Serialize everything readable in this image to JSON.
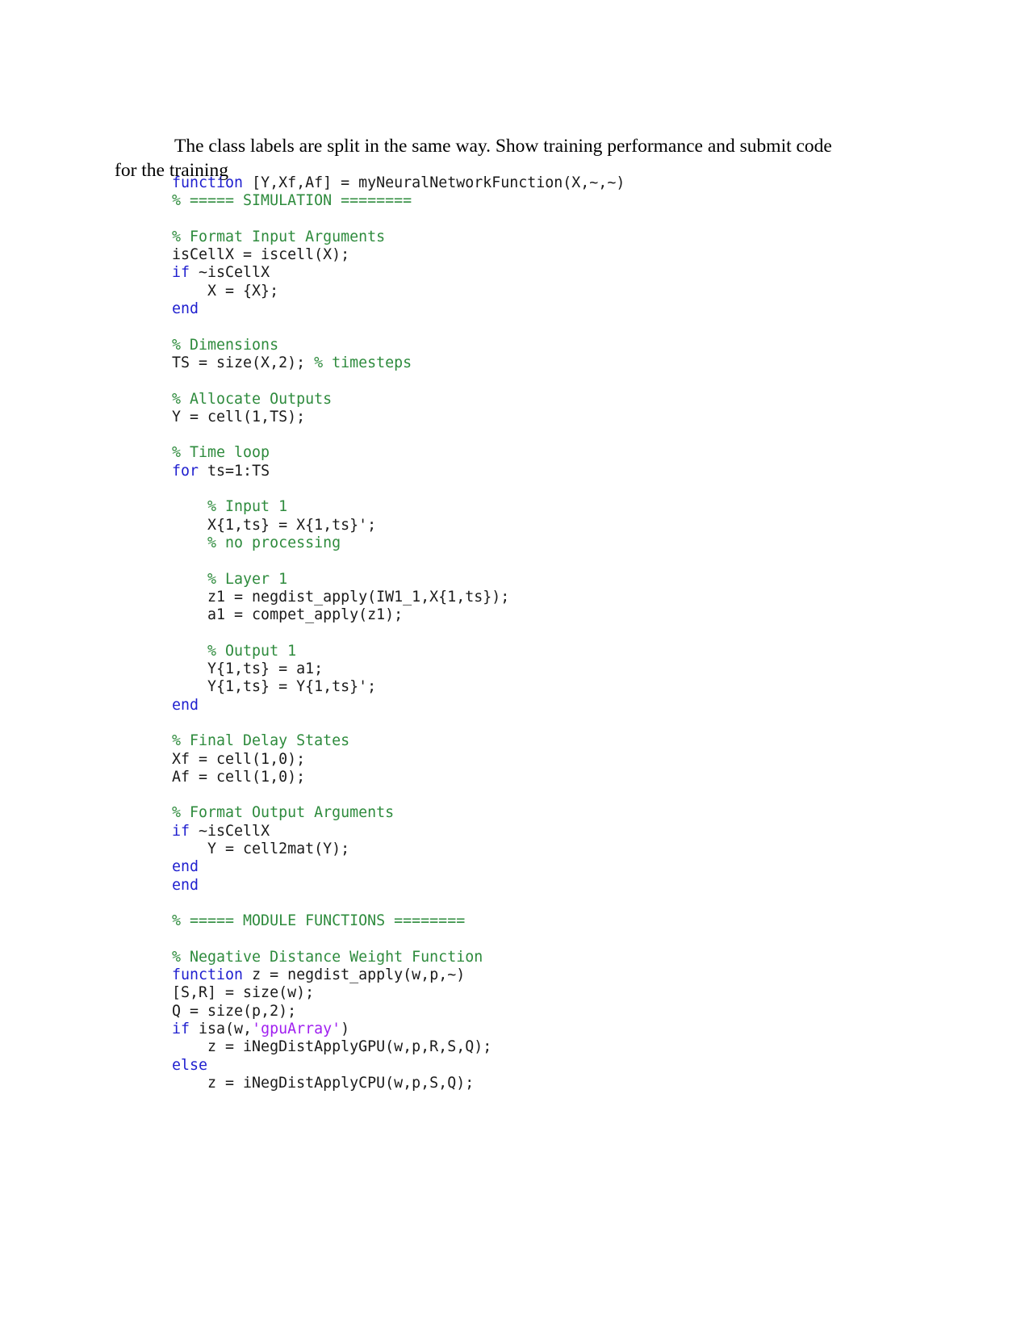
{
  "document": {
    "paragraph": "The class labels are split in the same way. Show training performance and submit code for the training",
    "colors": {
      "keyword": "#1f1fcf",
      "comment": "#2e8b3d",
      "string": "#a020f0",
      "plain": "#1a1a1a",
      "page_background": "#ffffff"
    },
    "code_listing": {
      "language": "matlab",
      "lines": [
        [
          {
            "t": "function",
            "c": "kw"
          },
          {
            "t": " [Y,Xf,Af] = myNeuralNetworkFunction(X,~,~)",
            "c": "plain"
          }
        ],
        [
          {
            "t": "% ===== SIMULATION ========",
            "c": "cmt"
          }
        ],
        [
          {
            "t": "",
            "c": "plain"
          }
        ],
        [
          {
            "t": "% Format Input Arguments",
            "c": "cmt"
          }
        ],
        [
          {
            "t": "isCellX = iscell(X);",
            "c": "plain"
          }
        ],
        [
          {
            "t": "if",
            "c": "kw"
          },
          {
            "t": " ~isCellX",
            "c": "plain"
          }
        ],
        [
          {
            "t": "    X = {X};",
            "c": "plain"
          }
        ],
        [
          {
            "t": "end",
            "c": "kw"
          }
        ],
        [
          {
            "t": "",
            "c": "plain"
          }
        ],
        [
          {
            "t": "% Dimensions",
            "c": "cmt"
          }
        ],
        [
          {
            "t": "TS = size(X,2); ",
            "c": "plain"
          },
          {
            "t": "% timesteps",
            "c": "cmt"
          }
        ],
        [
          {
            "t": "",
            "c": "plain"
          }
        ],
        [
          {
            "t": "% Allocate Outputs",
            "c": "cmt"
          }
        ],
        [
          {
            "t": "Y = cell(1,TS);",
            "c": "plain"
          }
        ],
        [
          {
            "t": "",
            "c": "plain"
          }
        ],
        [
          {
            "t": "% Time loop",
            "c": "cmt"
          }
        ],
        [
          {
            "t": "for",
            "c": "kw"
          },
          {
            "t": " ts=1:TS",
            "c": "plain"
          }
        ],
        [
          {
            "t": "",
            "c": "plain"
          }
        ],
        [
          {
            "t": "    % Input 1",
            "c": "cmt"
          }
        ],
        [
          {
            "t": "    X{1,ts} = X{1,ts}';",
            "c": "plain"
          }
        ],
        [
          {
            "t": "    % no processing",
            "c": "cmt"
          }
        ],
        [
          {
            "t": "",
            "c": "plain"
          }
        ],
        [
          {
            "t": "    % Layer 1",
            "c": "cmt"
          }
        ],
        [
          {
            "t": "    z1 = negdist_apply(IW1_1,X{1,ts});",
            "c": "plain"
          }
        ],
        [
          {
            "t": "    a1 = compet_apply(z1);",
            "c": "plain"
          }
        ],
        [
          {
            "t": "",
            "c": "plain"
          }
        ],
        [
          {
            "t": "    % Output 1",
            "c": "cmt"
          }
        ],
        [
          {
            "t": "    Y{1,ts} = a1;",
            "c": "plain"
          }
        ],
        [
          {
            "t": "    Y{1,ts} = Y{1,ts}';",
            "c": "plain"
          }
        ],
        [
          {
            "t": "end",
            "c": "kw"
          }
        ],
        [
          {
            "t": "",
            "c": "plain"
          }
        ],
        [
          {
            "t": "% Final Delay States",
            "c": "cmt"
          }
        ],
        [
          {
            "t": "Xf = cell(1,0);",
            "c": "plain"
          }
        ],
        [
          {
            "t": "Af = cell(1,0);",
            "c": "plain"
          }
        ],
        [
          {
            "t": "",
            "c": "plain"
          }
        ],
        [
          {
            "t": "% Format Output Arguments",
            "c": "cmt"
          }
        ],
        [
          {
            "t": "if",
            "c": "kw"
          },
          {
            "t": " ~isCellX",
            "c": "plain"
          }
        ],
        [
          {
            "t": "    Y = cell2mat(Y);",
            "c": "plain"
          }
        ],
        [
          {
            "t": "end",
            "c": "kw"
          }
        ],
        [
          {
            "t": "end",
            "c": "kw"
          }
        ],
        [
          {
            "t": "",
            "c": "plain"
          }
        ],
        [
          {
            "t": "% ===== MODULE FUNCTIONS ========",
            "c": "cmt"
          }
        ],
        [
          {
            "t": "",
            "c": "plain"
          }
        ],
        [
          {
            "t": "% Negative Distance Weight Function",
            "c": "cmt"
          }
        ],
        [
          {
            "t": "function",
            "c": "kw"
          },
          {
            "t": " z = negdist_apply(w,p,~)",
            "c": "plain"
          }
        ],
        [
          {
            "t": "[S,R] = size(w);",
            "c": "plain"
          }
        ],
        [
          {
            "t": "Q = size(p,2);",
            "c": "plain"
          }
        ],
        [
          {
            "t": "if",
            "c": "kw"
          },
          {
            "t": " isa(w,",
            "c": "plain"
          },
          {
            "t": "'gpuArray'",
            "c": "str"
          },
          {
            "t": ")",
            "c": "plain"
          }
        ],
        [
          {
            "t": "    z = iNegDistApplyGPU(w,p,R,S,Q);",
            "c": "plain"
          }
        ],
        [
          {
            "t": "else",
            "c": "kw"
          }
        ],
        [
          {
            "t": "    z = iNegDistApplyCPU(w,p,S,Q);",
            "c": "plain"
          }
        ]
      ]
    }
  }
}
